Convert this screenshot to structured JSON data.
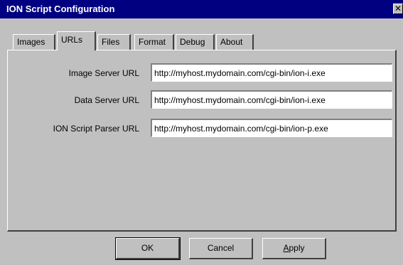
{
  "window": {
    "title": "ION Script Configuration",
    "close_glyph": "✕"
  },
  "tabs": [
    {
      "label": "Images",
      "active": false
    },
    {
      "label": "URLs",
      "active": true
    },
    {
      "label": "Files",
      "active": false
    },
    {
      "label": "Format",
      "active": false
    },
    {
      "label": "Debug",
      "active": false
    },
    {
      "label": "About",
      "active": false
    }
  ],
  "urls": {
    "image_server": {
      "label": "Image Server URL",
      "value": "http://myhost.mydomain.com/cgi-bin/ion-i.exe"
    },
    "data_server": {
      "label": "Data Server URL",
      "value": "http://myhost.mydomain.com/cgi-bin/ion-i.exe"
    },
    "script_parser": {
      "label": "ION Script Parser URL",
      "value": "http://myhost.mydomain.com/cgi-bin/ion-p.exe"
    }
  },
  "buttons": {
    "ok": "OK",
    "cancel": "Cancel",
    "apply": "Apply"
  },
  "colors": {
    "titlebar": "#000080",
    "face": "#c0c0c0"
  }
}
